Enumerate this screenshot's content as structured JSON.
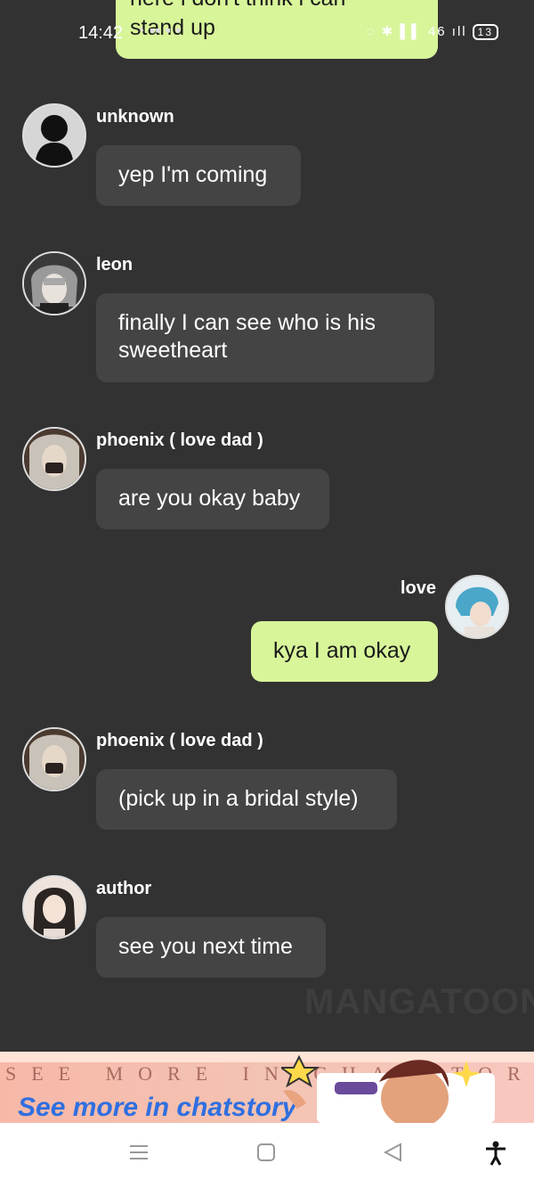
{
  "status_bar": {
    "time": "14:42",
    "indicators": "◌ ✱ ▌▌ 46 ıll",
    "battery": "13"
  },
  "top_bubble": {
    "lines": [
      "here i don't think i can",
      "stand up"
    ]
  },
  "messages": [
    {
      "name": "unknown",
      "text": "yep I'm coming",
      "side": "left"
    },
    {
      "name": "leon",
      "text": "finally I can see who is his sweetheart",
      "side": "left"
    },
    {
      "name": "phoenix ( love dad )",
      "text": "are you okay baby",
      "side": "left"
    },
    {
      "name": "love",
      "text": "kya I am okay",
      "side": "right"
    },
    {
      "name": "phoenix ( love dad )",
      "text": "(pick up in a bridal style)",
      "side": "left"
    },
    {
      "name": "author",
      "text": "see you next time",
      "side": "left"
    }
  ],
  "watermark": "MANGATOON",
  "banner": {
    "headline": "SEE MORE IN CHATSTORY",
    "subtext": "See more in chatstory"
  },
  "navbar": {
    "menu_icon": "menu-icon",
    "home_icon": "home-square-icon",
    "back_icon": "back-triangle-icon",
    "accessibility_icon": "accessibility-icon"
  }
}
